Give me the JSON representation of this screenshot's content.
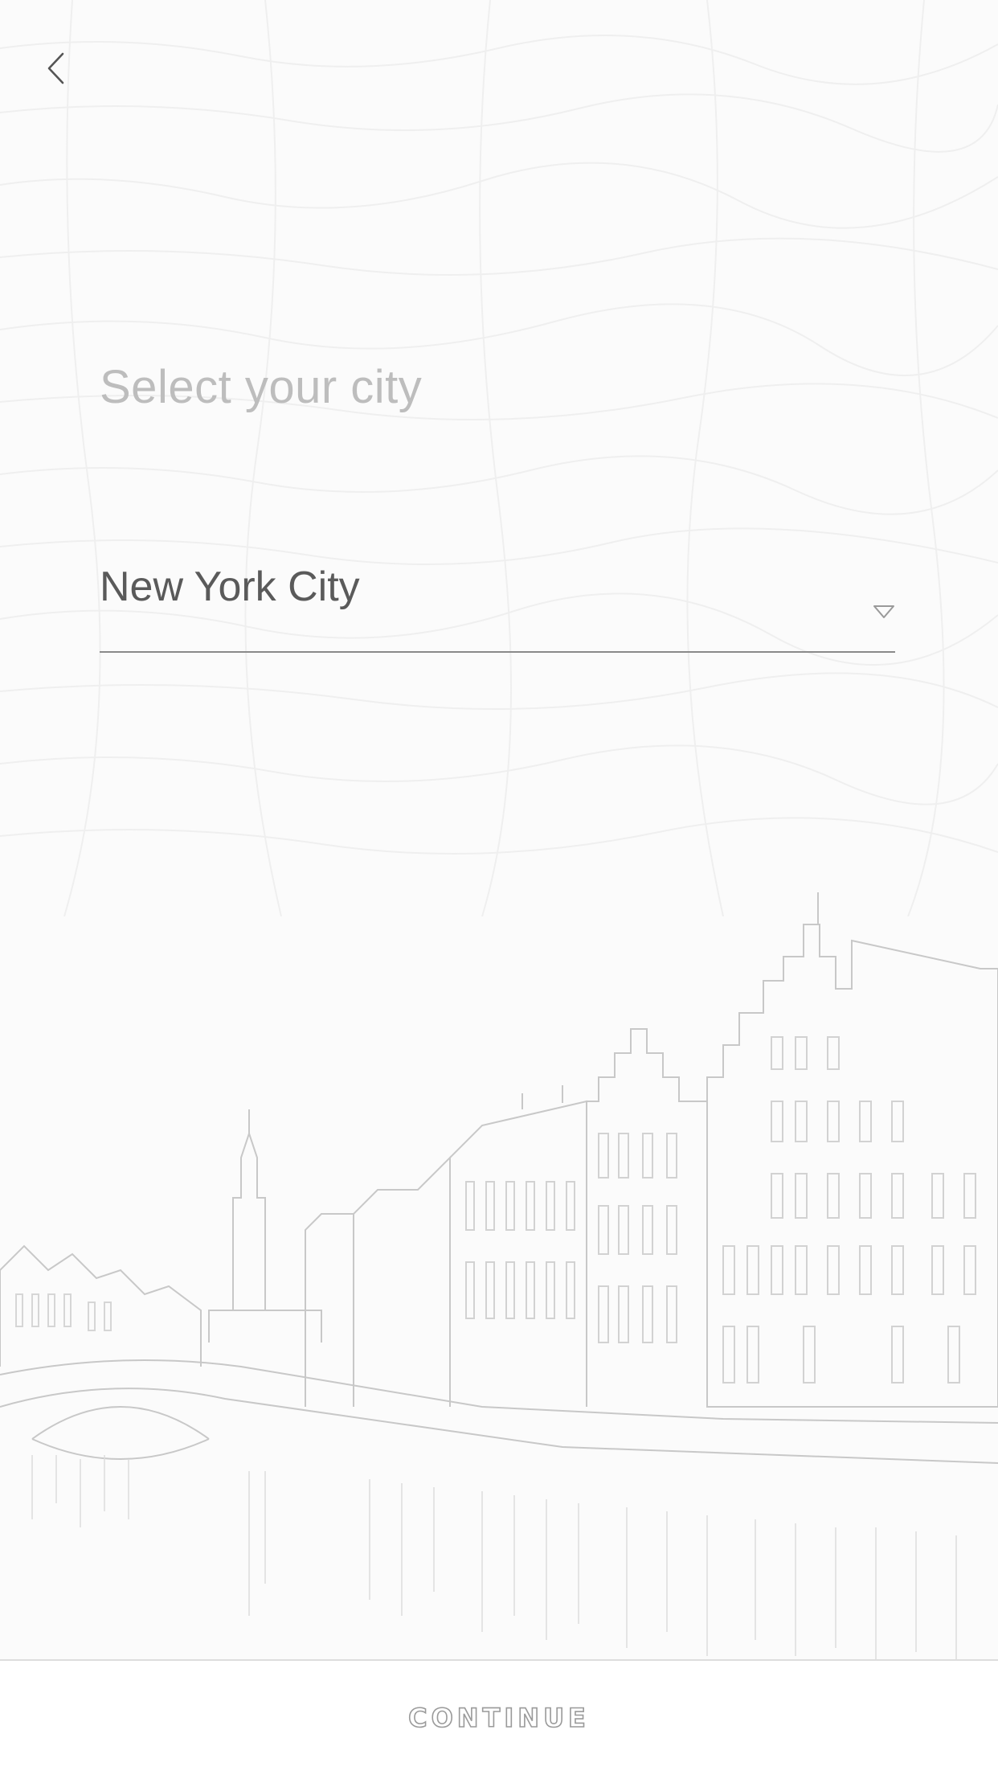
{
  "header": {
    "back_icon": "chevron-left-icon"
  },
  "title": "Select your city",
  "city_select": {
    "value": "New York City",
    "icon": "triangle-down-icon"
  },
  "illustration": {
    "subject": "canal-townhouses-sketch"
  },
  "footer": {
    "continue_label": "CONTINUE"
  },
  "colors": {
    "background": "#fbfbfb",
    "title_text": "#bdbdbd",
    "value_text": "#5a5a5a",
    "underline": "#8a8a8a",
    "sketch_line": "#c8c8c8"
  }
}
